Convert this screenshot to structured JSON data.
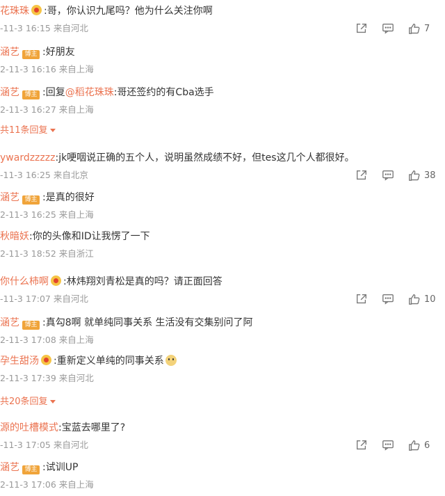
{
  "comments": [
    {
      "user": "花珠珠",
      "vip": true,
      "sep": ":",
      "text": "哥，你认识九尾吗？他为什么关注你啊",
      "time": "-11-3 16:15 来自河北",
      "actions": true,
      "likes": "7"
    },
    {
      "user": "涵艺",
      "badge": "博主",
      "sep": ":",
      "text": "好朋友",
      "time": "2-11-3 16:16 来自上海"
    },
    {
      "user": "涵艺",
      "badge": "博主",
      "sep": ":",
      "reply_prefix": "回复",
      "mention": "@稻花珠珠",
      "text": ":哥还签约的有Cba选手",
      "time": "2-11-3 16:27 来自上海"
    },
    {
      "more": "共11条回复"
    },
    {
      "user": "ywardzzzzz",
      "sep": ":",
      "text": "jk哽咽说正确的五个人，说明虽然成绩不好，但tes这几个人都很好。",
      "time": "-11-3 16:25 来自北京",
      "actions": true,
      "likes": "38"
    },
    {
      "user": "涵艺",
      "badge": "博主",
      "sep": ":",
      "text": "是真的很好",
      "time": "2-11-3 16:25 来自上海"
    },
    {
      "user": "秋暗妖",
      "sep": ":",
      "text": "你的头像和ID让我愣了一下",
      "time": "2-11-3 18:52 来自浙江"
    },
    {
      "user": "你什么柿啊",
      "vip": true,
      "sep": ":",
      "text": "林炜翔刘青松是真的吗？请正面回答",
      "time": "-11-3 17:07 来自河北",
      "actions": true,
      "likes": "10"
    },
    {
      "user": "涵艺",
      "badge": "博主",
      "sep": ":",
      "text": "真勾8啊 就单纯同事关系 生活没有交集别问了阿",
      "time": "2-11-3 17:08 来自上海"
    },
    {
      "user": "孕生甜汤",
      "vip": true,
      "sep": ":",
      "text": "重新定义单纯的同事关系",
      "emoji": true,
      "time": "2-11-3 17:39 来自河北"
    },
    {
      "more": "共20条回复"
    },
    {
      "user": "源的吐槽模式",
      "sep": ":",
      "text": "宝蓝去哪里了?",
      "time": "-11-3 17:05 来自河北",
      "actions": true,
      "likes": "6"
    },
    {
      "user": "涵艺",
      "badge": "博主",
      "sep": ":",
      "text": "试训UP",
      "time": "2-11-3 17:06 来自上海"
    }
  ],
  "icons": {
    "share": "share-icon",
    "comment": "comment-icon",
    "like": "thumb-up-icon"
  },
  "colors": {
    "name": "#eb7350",
    "meta": "#999999",
    "badge": "#f0a43a"
  }
}
